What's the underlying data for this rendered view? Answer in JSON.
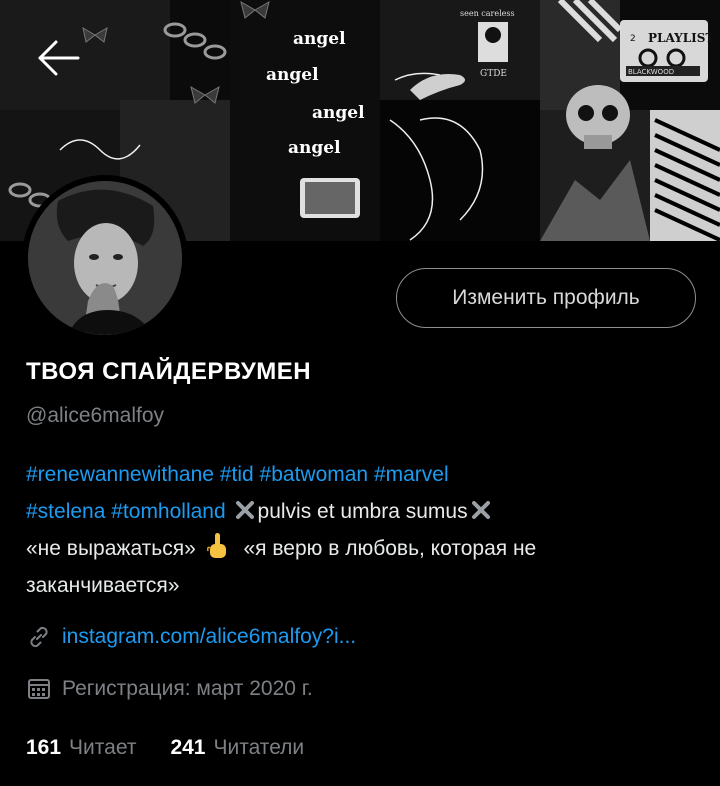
{
  "banner": {
    "angel_words": [
      "angel",
      "angel",
      "angel",
      "angel"
    ],
    "top_text": "seen careless",
    "rune": "GTDE",
    "playlist_number": "2",
    "playlist_label": "PLAYLIST",
    "playlist_sub": "BLACKWOOD"
  },
  "profile": {
    "edit_button": "Изменить профиль",
    "display_name": "ТВОЯ СПАЙДЕРВУМЕН",
    "handle": "@alice6malfoy",
    "bio": {
      "hashtags_line1": [
        "#renewannewithane",
        "#tid",
        "#batwoman",
        "#marvel"
      ],
      "hashtags_line2": [
        "#stelena",
        "#tomholland"
      ],
      "motto": "pulvis et umbra sumus",
      "quote1": "«не выражаться»",
      "quote2_part1": "«я верю в любовь, которая не",
      "quote2_part2": "заканчивается»"
    },
    "link": "instagram.com/alice6malfoy?i...",
    "registration": "Регистрация: март 2020 г.",
    "following_count": "161",
    "following_label": "Читает",
    "followers_count": "241",
    "followers_label": "Читатели"
  },
  "colors": {
    "accent": "#1d9bf0",
    "muted": "#7d8185",
    "background": "#000000"
  }
}
